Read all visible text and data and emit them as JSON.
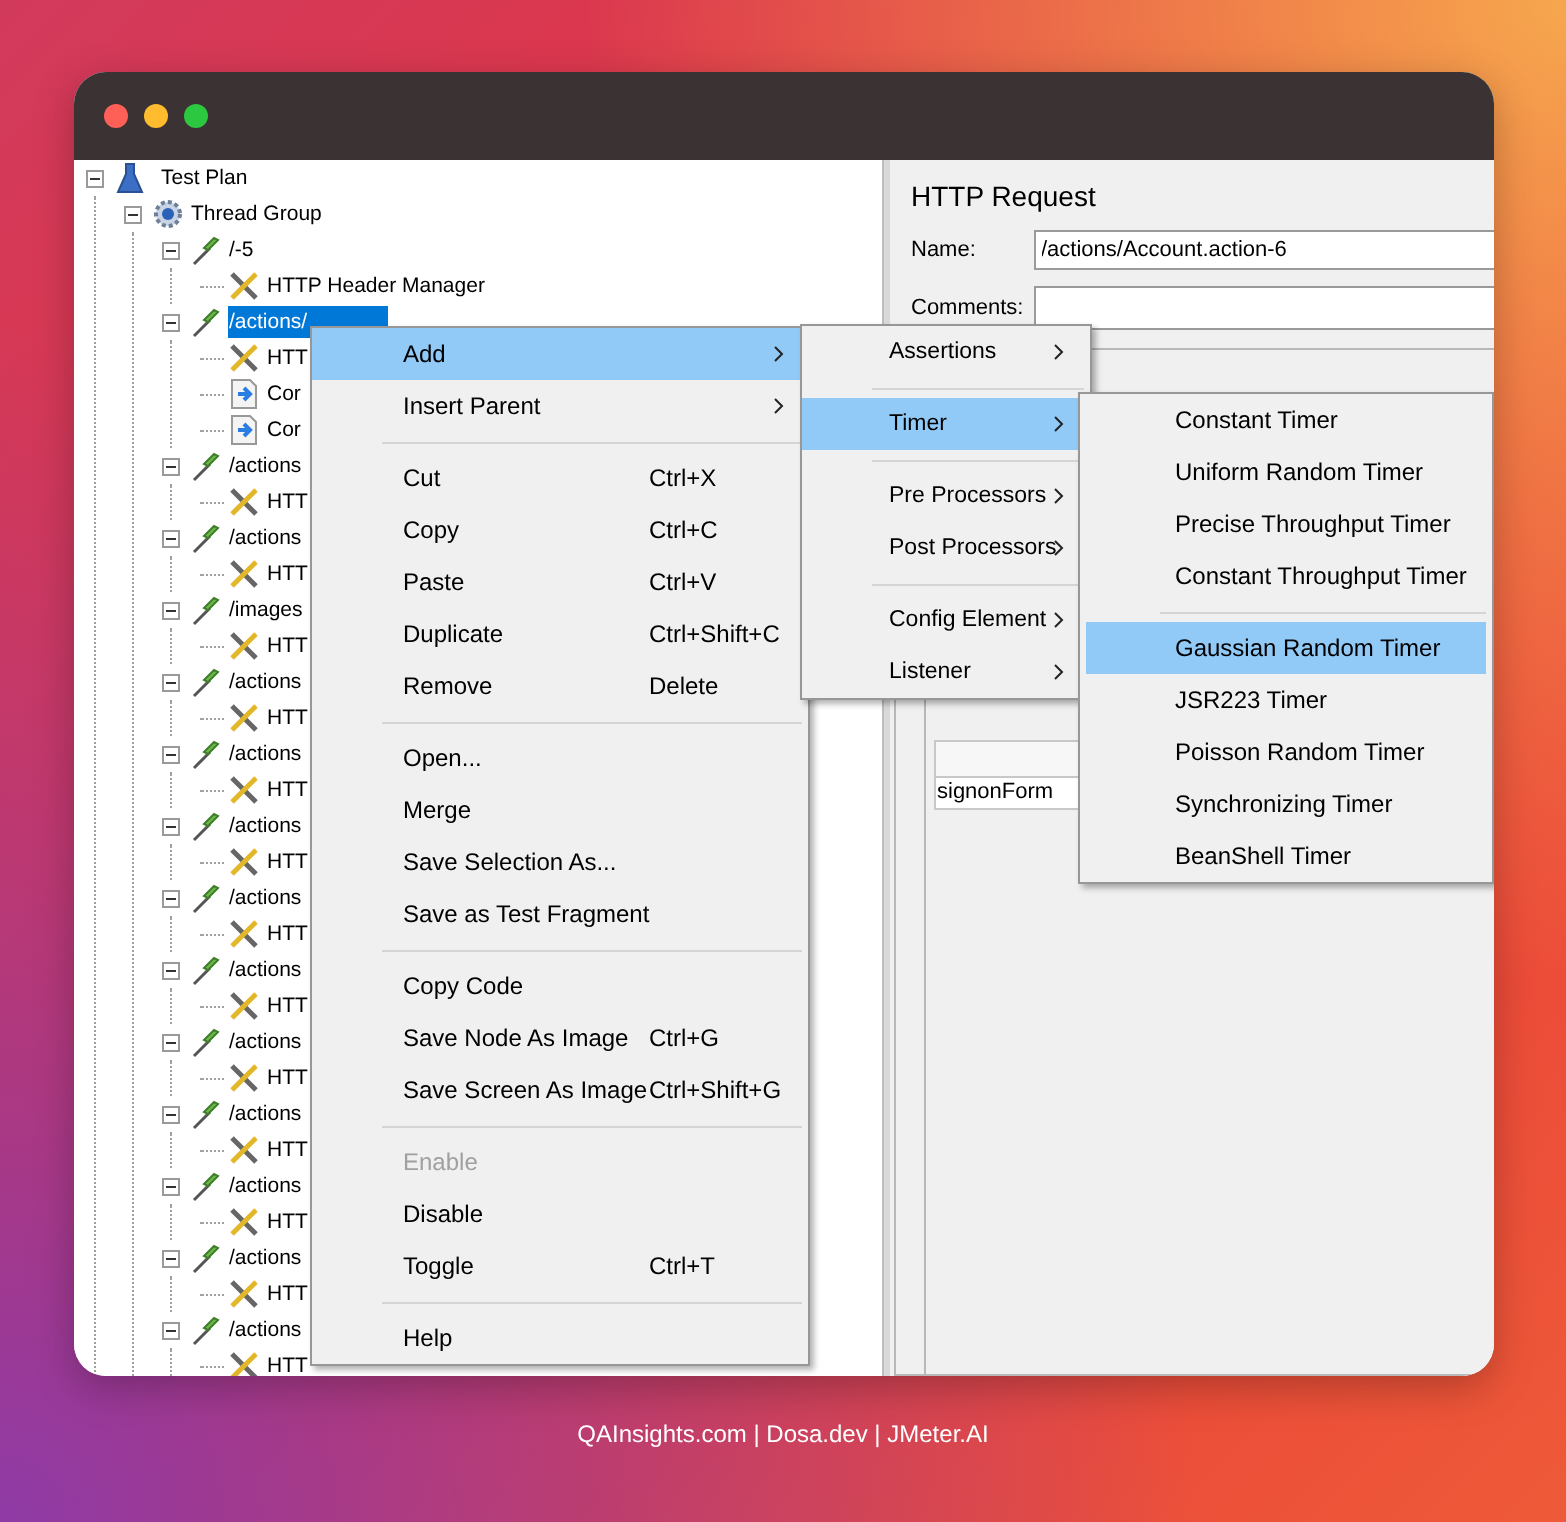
{
  "tree": [
    {
      "label": "Test Plan",
      "kind": "plan",
      "selected": false,
      "expanded": true,
      "children": [
        {
          "label": "Thread Group",
          "kind": "group",
          "selected": false,
          "expanded": true,
          "children": [
            {
              "label": "/-5",
              "kind": "sampler",
              "selected": false,
              "expanded": true,
              "children": [
                {
                  "label": "HTTP Header Manager",
                  "kind": "config",
                  "selected": false
                }
              ]
            },
            {
              "label": "/actions/",
              "kind": "sampler",
              "selected": true,
              "expanded": true,
              "children": [
                {
                  "label": "HTT",
                  "kind": "config",
                  "selected": false
                },
                {
                  "label": "Cor",
                  "kind": "extractor",
                  "selected": false
                },
                {
                  "label": "Cor",
                  "kind": "extractor",
                  "selected": false
                }
              ]
            },
            {
              "label": "/actions",
              "kind": "sampler",
              "selected": false,
              "expanded": true,
              "children": [
                {
                  "label": "HTT",
                  "kind": "config",
                  "selected": false
                }
              ]
            },
            {
              "label": "/actions",
              "kind": "sampler",
              "selected": false,
              "expanded": true,
              "children": [
                {
                  "label": "HTT",
                  "kind": "config",
                  "selected": false
                }
              ]
            },
            {
              "label": "/images",
              "kind": "sampler",
              "selected": false,
              "expanded": true,
              "children": [
                {
                  "label": "HTT",
                  "kind": "config",
                  "selected": false
                }
              ]
            },
            {
              "label": "/actions",
              "kind": "sampler",
              "selected": false,
              "expanded": true,
              "children": [
                {
                  "label": "HTT",
                  "kind": "config",
                  "selected": false
                }
              ]
            },
            {
              "label": "/actions",
              "kind": "sampler",
              "selected": false,
              "expanded": true,
              "children": [
                {
                  "label": "HTT",
                  "kind": "config",
                  "selected": false
                }
              ]
            },
            {
              "label": "/actions",
              "kind": "sampler",
              "selected": false,
              "expanded": true,
              "children": [
                {
                  "label": "HTT",
                  "kind": "config",
                  "selected": false
                }
              ]
            },
            {
              "label": "/actions",
              "kind": "sampler",
              "selected": false,
              "expanded": true,
              "children": [
                {
                  "label": "HTT",
                  "kind": "config",
                  "selected": false
                }
              ]
            },
            {
              "label": "/actions",
              "kind": "sampler",
              "selected": false,
              "expanded": true,
              "children": [
                {
                  "label": "HTT",
                  "kind": "config",
                  "selected": false
                }
              ]
            },
            {
              "label": "/actions",
              "kind": "sampler",
              "selected": false,
              "expanded": true,
              "children": [
                {
                  "label": "HTT",
                  "kind": "config",
                  "selected": false
                }
              ]
            },
            {
              "label": "/actions",
              "kind": "sampler",
              "selected": false,
              "expanded": true,
              "children": [
                {
                  "label": "HTT",
                  "kind": "config",
                  "selected": false
                }
              ]
            },
            {
              "label": "/actions",
              "kind": "sampler",
              "selected": false,
              "expanded": true,
              "children": [
                {
                  "label": "HTT",
                  "kind": "config",
                  "selected": false
                }
              ]
            },
            {
              "label": "/actions",
              "kind": "sampler",
              "selected": false,
              "expanded": true,
              "children": [
                {
                  "label": "HTT",
                  "kind": "config",
                  "selected": false
                }
              ]
            },
            {
              "label": "/actions",
              "kind": "sampler",
              "selected": false,
              "expanded": true,
              "children": [
                {
                  "label": "HTT",
                  "kind": "config",
                  "selected": false
                }
              ]
            }
          ]
        }
      ]
    }
  ],
  "editor": {
    "title": "HTTP Request",
    "name_label": "Name:",
    "name_value": "/actions/Account.action-6",
    "comments_label": "Comments:",
    "table_cell": "signonForm"
  },
  "context_menu": [
    {
      "label": "Add",
      "submenu": true,
      "selected": true,
      "disabled": false
    },
    {
      "label": "Insert Parent",
      "submenu": true,
      "selected": false,
      "disabled": false,
      "separator_after": true
    },
    {
      "label": "Cut",
      "shortcut": "Ctrl+X",
      "selected": false,
      "disabled": false
    },
    {
      "label": "Copy",
      "shortcut": "Ctrl+C",
      "selected": false,
      "disabled": false
    },
    {
      "label": "Paste",
      "shortcut": "Ctrl+V",
      "selected": false,
      "disabled": false
    },
    {
      "label": "Duplicate",
      "shortcut": "Ctrl+Shift+C",
      "selected": false,
      "disabled": false
    },
    {
      "label": "Remove",
      "shortcut": "Delete",
      "selected": false,
      "disabled": false,
      "separator_after": true
    },
    {
      "label": "Open...",
      "selected": false,
      "disabled": false
    },
    {
      "label": "Merge",
      "selected": false,
      "disabled": false
    },
    {
      "label": "Save Selection As...",
      "selected": false,
      "disabled": false
    },
    {
      "label": "Save as Test Fragment",
      "selected": false,
      "disabled": false,
      "separator_after": true
    },
    {
      "label": "Copy Code",
      "selected": false,
      "disabled": false
    },
    {
      "label": "Save Node As Image",
      "shortcut": "Ctrl+G",
      "selected": false,
      "disabled": false
    },
    {
      "label": "Save Screen As Image",
      "shortcut": "Ctrl+Shift+G",
      "selected": false,
      "disabled": false,
      "separator_after": true
    },
    {
      "label": "Enable",
      "selected": false,
      "disabled": true
    },
    {
      "label": "Disable",
      "selected": false,
      "disabled": false
    },
    {
      "label": "Toggle",
      "shortcut": "Ctrl+T",
      "selected": false,
      "disabled": false,
      "separator_after": true
    },
    {
      "label": "Help",
      "selected": false,
      "disabled": false
    }
  ],
  "add_menu": [
    {
      "label": "Assertions",
      "submenu": true,
      "selected": false,
      "separator_after": true
    },
    {
      "label": "Timer",
      "submenu": true,
      "selected": true,
      "separator_after": true
    },
    {
      "label": "Pre Processors",
      "submenu": true,
      "selected": false
    },
    {
      "label": "Post Processors",
      "submenu": true,
      "selected": false,
      "separator_after": true
    },
    {
      "label": "Config Element",
      "submenu": true,
      "selected": false
    },
    {
      "label": "Listener",
      "submenu": true,
      "selected": false
    }
  ],
  "timer_menu": [
    {
      "label": "Constant Timer",
      "selected": false
    },
    {
      "label": "Uniform Random Timer",
      "selected": false
    },
    {
      "label": "Precise Throughput Timer",
      "selected": false
    },
    {
      "label": "Constant Throughput Timer",
      "selected": false,
      "separator_after": true
    },
    {
      "label": "Gaussian Random Timer",
      "selected": true
    },
    {
      "label": "JSR223 Timer",
      "selected": false
    },
    {
      "label": "Poisson Random Timer",
      "selected": false
    },
    {
      "label": "Synchronizing Timer",
      "selected": false
    },
    {
      "label": "BeanShell Timer",
      "selected": false
    }
  ],
  "footer": "QAInsights.com | Dosa.dev | JMeter.AI"
}
